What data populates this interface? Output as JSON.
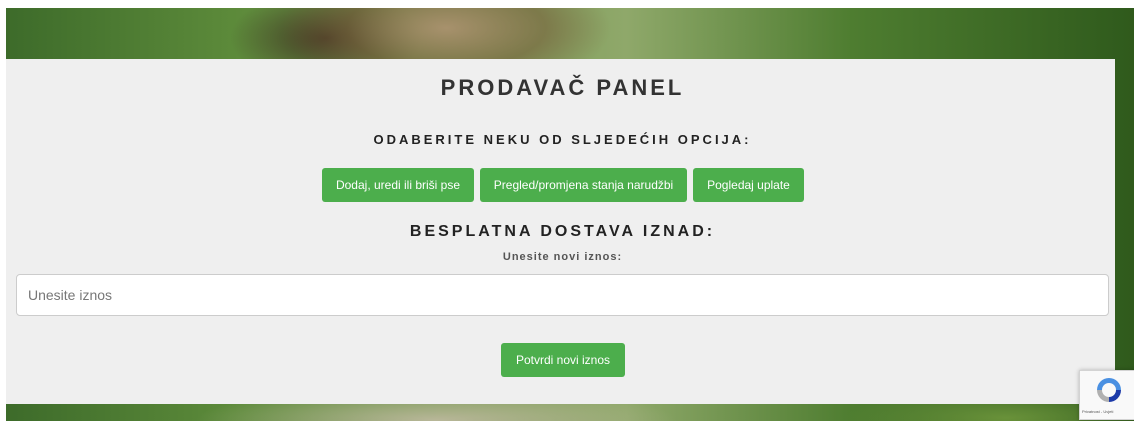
{
  "panel": {
    "title": "PRODAVAČ PANEL",
    "subtitle": "ODABERITE NEKU OD SLJEDEĆIH OPCIJA:"
  },
  "actions": {
    "dogs_label": "Dodaj, uredi ili briši pse",
    "orders_label": "Pregled/promjena stanja narudžbi",
    "payments_label": "Pogledaj uplate"
  },
  "shipping": {
    "heading": "BESPLATNA DOSTAVA IZNAD:",
    "label": "Unesite novi iznos:",
    "input_placeholder": "Unesite iznos",
    "input_value": "",
    "submit_label": "Potvrdi novi iznos"
  },
  "recaptcha": {
    "icon": "recaptcha-icon",
    "text": "Privatnost - Uvjeti"
  },
  "colors": {
    "button_bg": "#4cae4c",
    "panel_bg": "#efefef"
  }
}
